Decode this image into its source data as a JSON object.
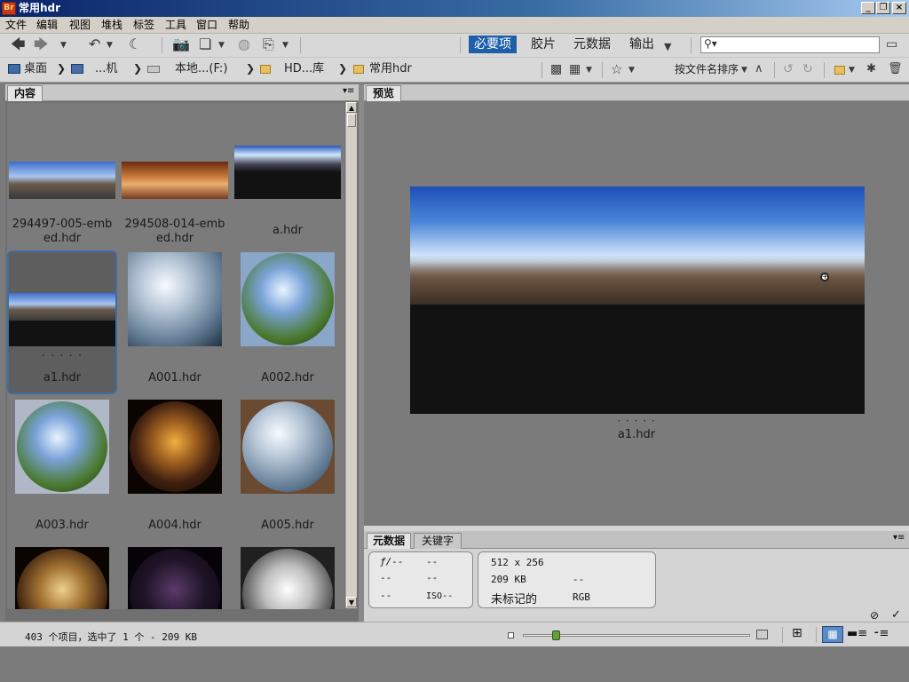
{
  "window": {
    "title": "常用hdr",
    "app_icon_text": "Br"
  },
  "menu": [
    "文件",
    "编辑",
    "视图",
    "堆栈",
    "标签",
    "工具",
    "窗口",
    "帮助"
  ],
  "workspaces": [
    "必要项",
    "胶片",
    "元数据",
    "输出"
  ],
  "search": {
    "value": "",
    "icon": "magnifier-icon"
  },
  "breadcrumb": [
    {
      "label": "桌面",
      "icon": "desktop-icon"
    },
    {
      "label": "...机",
      "icon": "computer-icon"
    },
    {
      "label": "本地...(F:)",
      "icon": "drive-icon"
    },
    {
      "label": "HD...库",
      "icon": "folder-icon"
    },
    {
      "label": "常用hdr",
      "icon": "folder-icon"
    }
  ],
  "sort_label": "按文件名排序",
  "panels": {
    "content": "内容",
    "preview": "预览"
  },
  "thumbnails": [
    {
      "name": "294497-005-embed.hdr",
      "line1": "294497-005-emb",
      "line2": "ed.hdr",
      "kind": "pano"
    },
    {
      "name": "294508-014-embed.hdr",
      "line1": "294508-014-emb",
      "line2": "ed.hdr",
      "kind": "pano-warm"
    },
    {
      "name": "a.hdr",
      "line1": "a.hdr",
      "line2": "",
      "kind": "pano-dark"
    },
    {
      "name": "a1.hdr",
      "line1": "a1.hdr",
      "line2": "",
      "kind": "pano",
      "selected": true,
      "rating": "· · · · ·"
    },
    {
      "name": "A001.hdr",
      "line1": "A001.hdr",
      "line2": "",
      "kind": "sphere-blue"
    },
    {
      "name": "A002.hdr",
      "line1": "A002.hdr",
      "line2": "",
      "kind": "sphere-green"
    },
    {
      "name": "A003.hdr",
      "line1": "A003.hdr",
      "line2": "",
      "kind": "sphere-green"
    },
    {
      "name": "A004.hdr",
      "line1": "A004.hdr",
      "line2": "",
      "kind": "sphere-night"
    },
    {
      "name": "A005.hdr",
      "line1": "A005.hdr",
      "line2": "",
      "kind": "sphere-blue"
    },
    {
      "name": "",
      "line1": "",
      "line2": "",
      "kind": "sphere-brown"
    },
    {
      "name": "",
      "line1": "",
      "line2": "",
      "kind": "sphere-dark"
    },
    {
      "name": "",
      "line1": "",
      "line2": "",
      "kind": "sphere-silver"
    }
  ],
  "preview": {
    "filename": "a1.hdr",
    "rating": "· · · · ·"
  },
  "metadata": {
    "tabs": [
      "元数据",
      "关键字"
    ],
    "camera": {
      "aperture": "ƒ/--",
      "shutter": "--",
      "r2a": "--",
      "r2b": "--",
      "r3a": "--",
      "iso": "ISO--"
    },
    "file": {
      "dimensions": "512 x 256",
      "size": "209 KB",
      "size_extra": "--",
      "profile": "未标记的",
      "mode": "RGB"
    }
  },
  "status": {
    "text": "403 个项目，选中了 1 个 - 209 KB",
    "zoom_fraction": 0.13
  }
}
